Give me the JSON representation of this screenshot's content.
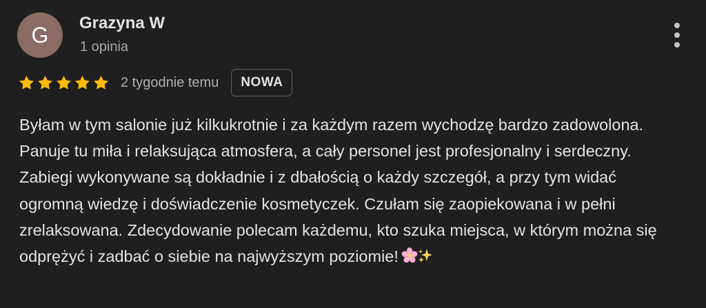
{
  "author": {
    "initial": "G",
    "name": "Grazyna W",
    "meta": "1 opinia",
    "avatar_color": "#8a6c64"
  },
  "review": {
    "rating": 5,
    "rating_max": 5,
    "date": "2 tygodnie temu",
    "badge": "NOWA",
    "text": "Byłam w tym salonie już kilkukrotnie i za każdym razem wychodzę bardzo zadowolona. Panuje tu miła i relaksująca atmosfera, a cały personel jest profesjonalny i serdeczny. Zabiegi wykonywane są dokładnie i z dbałością o każdy szczegół, a przy tym widać ogromną wiedzę i doświadczenie kosmetyczek. Czułam się zaopiekowana i w pełni zrelaksowana. Zdecydowanie polecam każdemu, kto szuka miejsca, w którym można się odprężyć i zadbać o siebie na najwyższym poziomie!",
    "emojis": [
      "cherry-blossom-icon",
      "sparkles-icon"
    ]
  },
  "colors": {
    "background": "#1f1f1f",
    "star": "#fbbc04",
    "text": "#e3e3e3",
    "muted": "#a8a8a8"
  },
  "icons": {
    "menu": "more-vert-icon",
    "star": "star-icon"
  }
}
